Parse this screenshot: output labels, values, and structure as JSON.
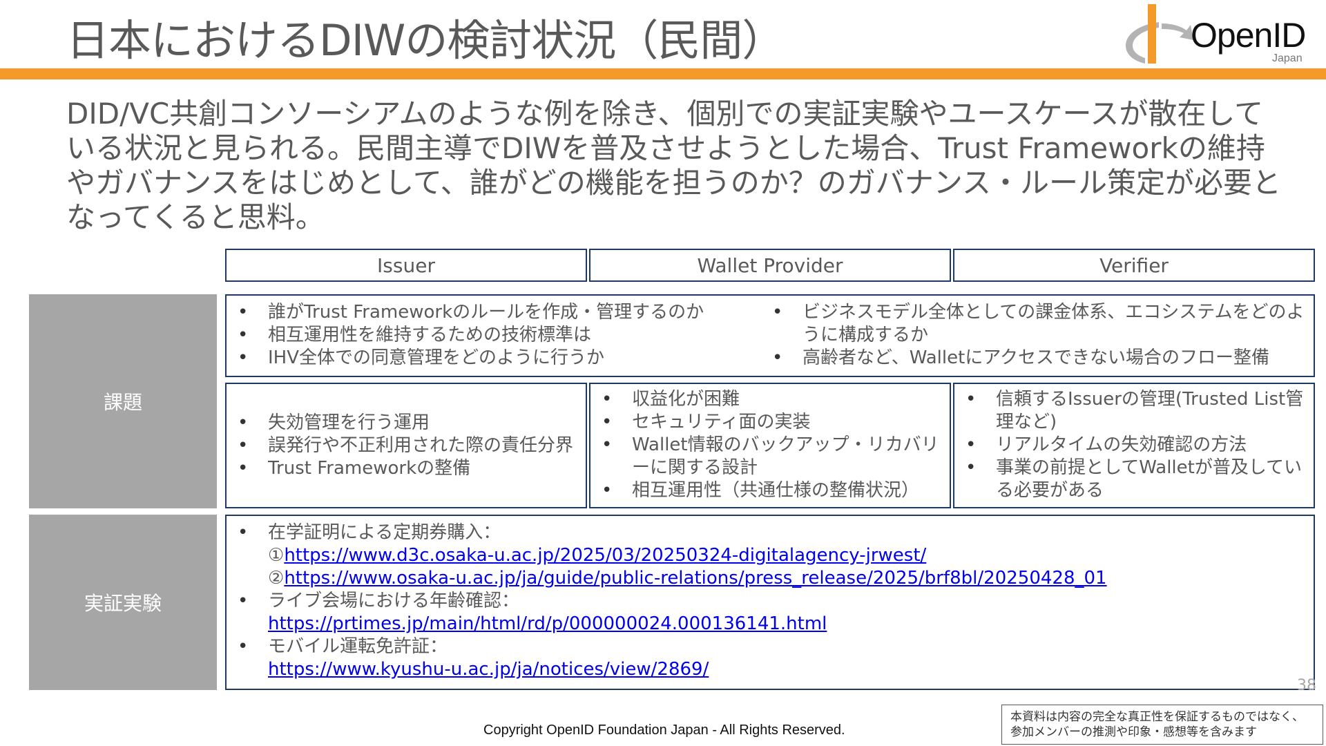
{
  "header": {
    "title": "日本におけるDIWの検討状況（民間）",
    "logo_text": "OpenID",
    "logo_sub": "Japan",
    "colors": {
      "accent": "#F39A2B",
      "border": "#1f3864",
      "side_fill": "#a6a6a6"
    }
  },
  "lead": "DID/VC共創コンソーシアムのような例を除き、個別での実証実験やユースケースが散在している状況と見られる。民間主導でDIWを普及させようとした場合、Trust Frameworkの維持やガバナンスをはじめとして、誰がどの機能を担うのか？のガバナンス・ルール策定が必要となってくると思料。",
  "columns": [
    "Issuer",
    "Wallet Provider",
    "Verifier"
  ],
  "kadai": {
    "label": "課題",
    "common_left": [
      "誰がTrust Frameworkのルールを作成・管理するのか",
      "相互運用性を維持するための技術標準は",
      "IHV全体での同意管理をどのように行うか"
    ],
    "common_right": [
      "ビジネスモデル全体としての課金体系、エコシステムをどのように構成するか",
      "高齢者など、Walletにアクセスできない場合のフロー整備"
    ],
    "issuer": [
      "失効管理を行う運用",
      "誤発行や不正利用された際の責任分界",
      "Trust Frameworkの整備"
    ],
    "wallet": [
      "収益化が困難",
      "セキュリティ面の実装",
      "Wallet情報のバックアップ・リカバリーに関する設計",
      "相互運用性（共通仕様の整備状況）"
    ],
    "verifier": [
      "信頼するIssuerの管理(Trusted List管理など)",
      "リアルタイムの失効確認の方法",
      "事業の前提としてWalletが普及している必要がある"
    ]
  },
  "jissho": {
    "label": "実証実験",
    "item1": "在学証明による定期券購入：",
    "item1_prefix1": "①",
    "item1_link1": "https://www.d3c.osaka-u.ac.jp/2025/03/20250324-digitalagency-jrwest/",
    "item1_prefix2": "②",
    "item1_link2": "https://www.osaka-u.ac.jp/ja/guide/public-relations/press_release/2025/brf8bl/20250428_01",
    "item2": "ライブ会場における年齢確認：",
    "item2_link": "https://prtimes.jp/main/html/rd/p/000000024.000136141.html",
    "item3": "モバイル運転免許証：",
    "item3_link": "https://www.kyushu-u.ac.jp/ja/notices/view/2869/"
  },
  "page_number": "38",
  "copyright": "Copyright OpenID Foundation Japan - All Rights Reserved.",
  "disclaimer": "本資料は内容の完全な真正性を保証するものではなく、参加メンバーの推測や印象・感想等を含みます"
}
